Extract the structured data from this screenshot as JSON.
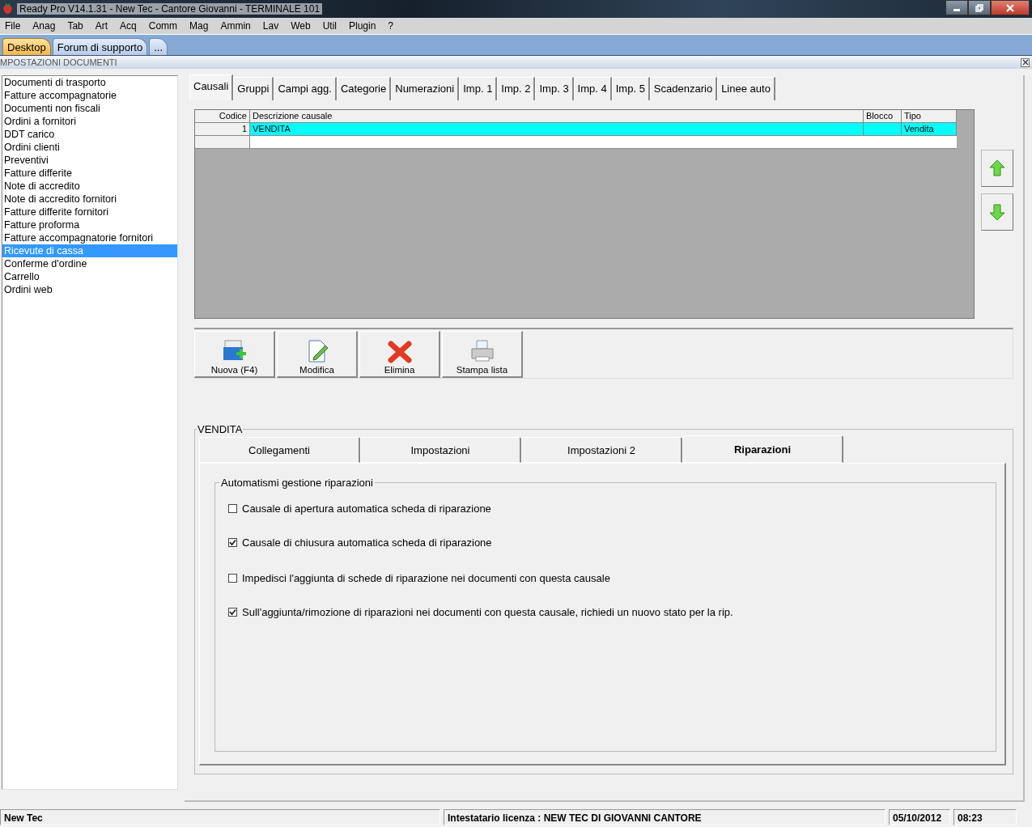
{
  "window": {
    "title": "Ready Pro V14.1.31 - New Tec - Cantore Giovanni - TERMINALE 101"
  },
  "menu": [
    "File",
    "Anag",
    "Tab",
    "Art",
    "Acq",
    "Comm",
    "Mag",
    "Ammin",
    "Lav",
    "Web",
    "Util",
    "Plugin",
    "?"
  ],
  "app_tabs": [
    {
      "label": "Desktop",
      "selected": true
    },
    {
      "label": "Forum di supporto",
      "selected": false
    },
    {
      "label": "...",
      "selected": false
    }
  ],
  "panel_title": "MPOSTAZIONI DOCUMENTI",
  "doc_types": [
    {
      "label": "Documenti di trasporto",
      "selected": false
    },
    {
      "label": "Fatture accompagnatorie",
      "selected": false
    },
    {
      "label": "Documenti non fiscali",
      "selected": false
    },
    {
      "label": "Ordini a fornitori",
      "selected": false
    },
    {
      "label": "DDT carico",
      "selected": false
    },
    {
      "label": "Ordini clienti",
      "selected": false
    },
    {
      "label": "Preventivi",
      "selected": false
    },
    {
      "label": "Fatture differite",
      "selected": false
    },
    {
      "label": "Note di accredito",
      "selected": false
    },
    {
      "label": "Note di accredito fornitori",
      "selected": false
    },
    {
      "label": "Fatture differite fornitori",
      "selected": false
    },
    {
      "label": "Fatture proforma",
      "selected": false
    },
    {
      "label": "Fatture accompagnatorie fornitori",
      "selected": false
    },
    {
      "label": "Ricevute di cassa",
      "selected": true
    },
    {
      "label": "Conferme d'ordine",
      "selected": false
    },
    {
      "label": "Carrello",
      "selected": false
    },
    {
      "label": "Ordini web",
      "selected": false
    }
  ],
  "tabs": [
    {
      "label": "Causali",
      "selected": true
    },
    {
      "label": "Gruppi",
      "selected": false
    },
    {
      "label": "Campi agg.",
      "selected": false
    },
    {
      "label": "Categorie",
      "selected": false
    },
    {
      "label": "Numerazioni",
      "selected": false
    },
    {
      "label": "Imp. 1",
      "selected": false
    },
    {
      "label": "Imp. 2",
      "selected": false
    },
    {
      "label": "Imp. 3",
      "selected": false
    },
    {
      "label": "Imp. 4",
      "selected": false
    },
    {
      "label": "Imp. 5",
      "selected": false
    },
    {
      "label": "Scadenzario",
      "selected": false
    },
    {
      "label": "Linee auto",
      "selected": false
    }
  ],
  "grid": {
    "columns": [
      "Codice",
      "Descrizione causale",
      "Blocco",
      "Tipo"
    ],
    "rows": [
      {
        "cells": [
          "1",
          "VENDITA",
          "",
          "Vendita"
        ],
        "selected": true
      }
    ]
  },
  "buttons": [
    {
      "label": "Nuova (F4)",
      "kind": "new"
    },
    {
      "label": "Modifica",
      "kind": "edit"
    },
    {
      "label": "Elimina",
      "kind": "delete"
    },
    {
      "label": "Stampa lista",
      "kind": "print"
    }
  ],
  "group_title": "VENDITA",
  "sub_tabs": [
    {
      "label": "Collegamenti",
      "selected": false
    },
    {
      "label": "Impostazioni",
      "selected": false
    },
    {
      "label": "Impostazioni 2",
      "selected": false
    },
    {
      "label": "Riparazioni",
      "selected": true
    }
  ],
  "options_group": {
    "title": "Automatismi gestione riparazioni",
    "options": [
      {
        "label": "Causale di apertura automatica scheda di riparazione",
        "checked": false
      },
      {
        "label": "Causale di chiusura automatica scheda di riparazione",
        "checked": true
      },
      {
        "label": "Impedisci l'aggiunta di schede di riparazione nei documenti con questa causale",
        "checked": false
      },
      {
        "label": "Sull'aggiunta/rimozione di riparazioni nei documenti con questa causale, richiedi un nuovo stato per la rip.",
        "checked": true
      }
    ]
  },
  "status_bar": {
    "company": "New Tec",
    "license": "Intestatario licenza : NEW TEC DI GIOVANNI CANTORE",
    "date": "05/10/2012",
    "time": "08:23"
  }
}
